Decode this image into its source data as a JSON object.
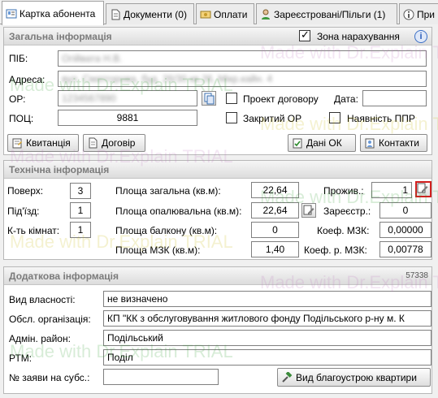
{
  "tabs": [
    {
      "label": "Картка абонента",
      "icon": "card-icon",
      "active": true
    },
    {
      "label": "Документи (0)",
      "icon": "document-icon",
      "active": false
    },
    {
      "label": "Оплати",
      "icon": "payments-icon",
      "active": false
    },
    {
      "label": "Зареєстровані/Пільги (1)",
      "icon": "person-icon",
      "active": false
    },
    {
      "label": "При",
      "icon": "info-icon",
      "active": false
    }
  ],
  "general": {
    "title": "Загальна інформація",
    "zone_label": "Зона нарахування",
    "zone_checked": true,
    "help_glyph": "i",
    "pib_label": "ПІБ:",
    "pib_value": "Огійвата Н.В.",
    "address_label": "Адреса:",
    "address_value": "вул. Сматгорова, буд. 26/30 кв.26, Мікр.кайн. 4",
    "or_label": "ОР:",
    "or_value": "1234567890",
    "project_label": "Проект договору",
    "date_label": "Дата:",
    "date_value": "",
    "poc_label": "ПОЦ:",
    "poc_value": "9881",
    "closed_label": "Закритий ОР",
    "ppr_label": "Наявність ППР",
    "receipt_button": "Квитанція",
    "contract_button": "Договір",
    "data_ok_button": "Дані ОК",
    "contacts_button": "Контакти"
  },
  "technical": {
    "title": "Технічна інформація",
    "floors_label": "Поверх:",
    "floors_value": "3",
    "entrance_label": "Під'їзд:",
    "entrance_value": "1",
    "rooms_label": "К-ть кімнат:",
    "rooms_value": "1",
    "total_area_label": "Площа загальна (кв.м):",
    "total_area_value": "22,64",
    "heated_area_label": "Площа опалювальна (кв.м):",
    "heated_area_value": "22,64",
    "balcony_area_label": "Площа балкону (кв.м):",
    "balcony_area_value": "0",
    "mzk_area_label": "Площа МЗК (кв.м):",
    "mzk_area_value": "1,40",
    "residing_label": "Прожив.:",
    "residing_value": "1",
    "registered_label": "Зареєстр.:",
    "registered_value": "0",
    "coef_mzk_label": "Коеф. МЗК:",
    "coef_mzk_value": "0,00000",
    "coef_r_mzk_label": "Коеф. р. МЗК:",
    "coef_r_mzk_value": "0,00778"
  },
  "additional": {
    "title": "Додаткова інформація",
    "code": "57338",
    "ownership_label": "Вид власності:",
    "ownership_value": "не визначено",
    "service_org_label": "Обсл. організація:",
    "service_org_value": "КП \"КК з обслуговування житлового фонду Подільського р-ну м. К",
    "admin_district_label": "Адмін. район:",
    "admin_district_value": "Подільський",
    "rtm_label": "РТМ:",
    "rtm_value": "Поділ",
    "subsidy_label": "№ заяви на субс.:",
    "subsidy_value": "",
    "improvement_button": "Вид благоустрою квартири"
  },
  "watermark": "Made with Dr.Explain TRIAL",
  "colors": {
    "highlight": "#d21f1f",
    "title_gray": "#7b7b7b",
    "help_blue": "#3b6fc6"
  }
}
